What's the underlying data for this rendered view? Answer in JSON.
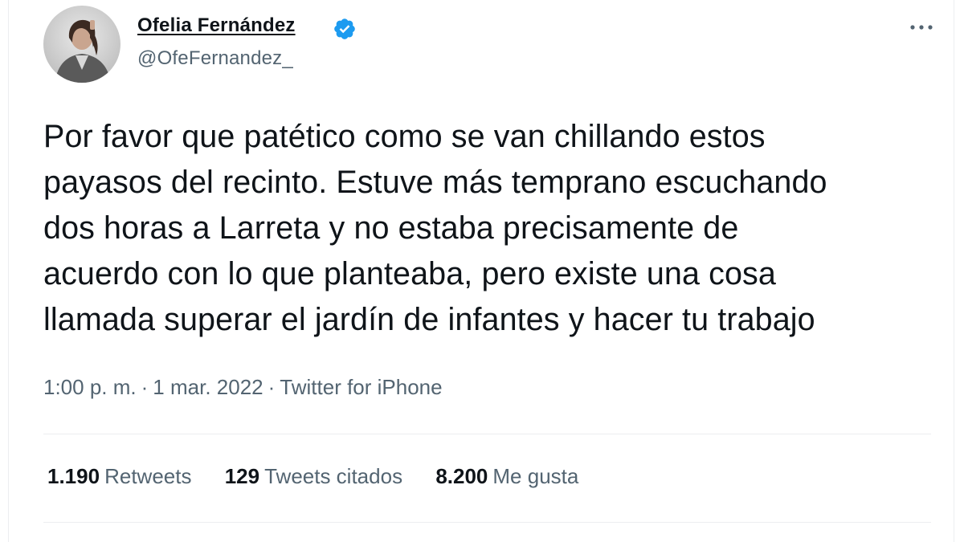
{
  "author": {
    "name": "Ofelia Fernández",
    "handle": "@OfeFernandez_",
    "verified": true,
    "verified_color": "#1d9bf0"
  },
  "tweet": {
    "text_lines": [
      "Por favor que patético como se van chillando estos",
      "payasos del recinto. Estuve más temprano escuchando",
      "dos horas a Larreta y no estaba precisamente de",
      "acuerdo con lo que planteaba, pero existe una cosa",
      "llamada superar el jardín de infantes y hacer tu trabajo"
    ],
    "time": "1:00 p. m.",
    "date": "1 mar. 2022",
    "source": "Twitter for iPhone",
    "separator": "·"
  },
  "stats": {
    "retweets": {
      "count": "1.190",
      "label": "Retweets"
    },
    "quotes": {
      "count": "129",
      "label": "Tweets citados"
    },
    "likes": {
      "count": "8.200",
      "label": "Me gusta"
    }
  },
  "icons": {
    "more": "more-horizontal-icon",
    "verified": "verified-badge-icon"
  },
  "colors": {
    "text": "#0f1419",
    "secondary": "#536471",
    "divider": "#eceef0",
    "brand": "#1d9bf0"
  }
}
